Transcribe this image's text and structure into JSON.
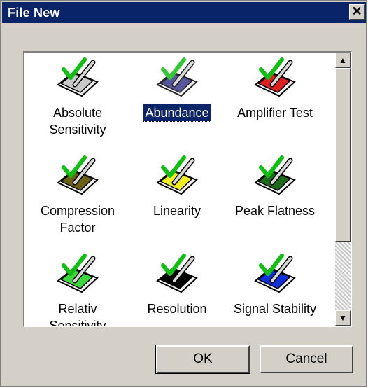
{
  "window": {
    "title": "File New",
    "close_label": "✕"
  },
  "items": [
    {
      "label": "Absolute\nSensitivity",
      "color": "#c8c8c8",
      "selected": false
    },
    {
      "label": "Abundance",
      "color": "#4a1a4a",
      "selected": true
    },
    {
      "label": "Amplifier Test",
      "color": "#e02020",
      "selected": false
    },
    {
      "label": "Compression\nFactor",
      "color": "#6b6014",
      "selected": false
    },
    {
      "label": "Linearity",
      "color": "#f0f020",
      "selected": false
    },
    {
      "label": "Peak Flatness",
      "color": "#1c6a1c",
      "selected": false
    },
    {
      "label": "Relativ\nSensitivity",
      "color": "#3cd83c",
      "selected": false
    },
    {
      "label": "Resolution",
      "color": "#000000",
      "selected": false
    },
    {
      "label": "Signal Stability",
      "color": "#1030e0",
      "selected": false
    }
  ],
  "icon_names": [
    "document-check-icon"
  ],
  "scrollbar": {
    "up": "▲",
    "down": "▼"
  },
  "buttons": {
    "ok": "OK",
    "cancel": "Cancel"
  }
}
